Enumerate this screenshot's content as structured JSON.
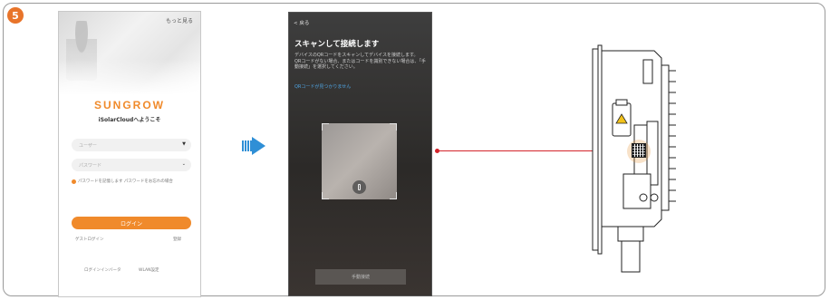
{
  "step": "5",
  "login": {
    "more_link": "もっと見る",
    "brand": "SUNGROW",
    "welcome": "iSolarCloudへようこそ",
    "user_placeholder": "ユーザー",
    "password_placeholder": "パスワード",
    "remember_text": "パスワードを記憶します パスワードをお忘れの場合",
    "login_button": "ログイン",
    "guest_login": "ゲストログイン",
    "register": "登録",
    "login_inverter": "ログインインバータ",
    "wlan_settings": "WLAN設定"
  },
  "scan": {
    "back": "< 戻る",
    "title": "スキャンして接続します",
    "description": "デバイスのQRコードをスキャンしてデバイスを接続します。\nQRコードがない場合、またはコードを識別できない場合は、「手動接続」を選択してください。",
    "no_qr_link": "QRコードが見つかりません",
    "manual_button": "手動接続"
  },
  "colors": {
    "accent": "#f08a2b",
    "step_badge": "#e8742a",
    "arrow": "#2f8fd6",
    "connector": "#d3242b",
    "link": "#4fa3e0"
  },
  "icons": [
    "chevron-down-icon",
    "flashlight-icon",
    "arrow-right-icon",
    "qr-code-icon",
    "warning-icon"
  ]
}
